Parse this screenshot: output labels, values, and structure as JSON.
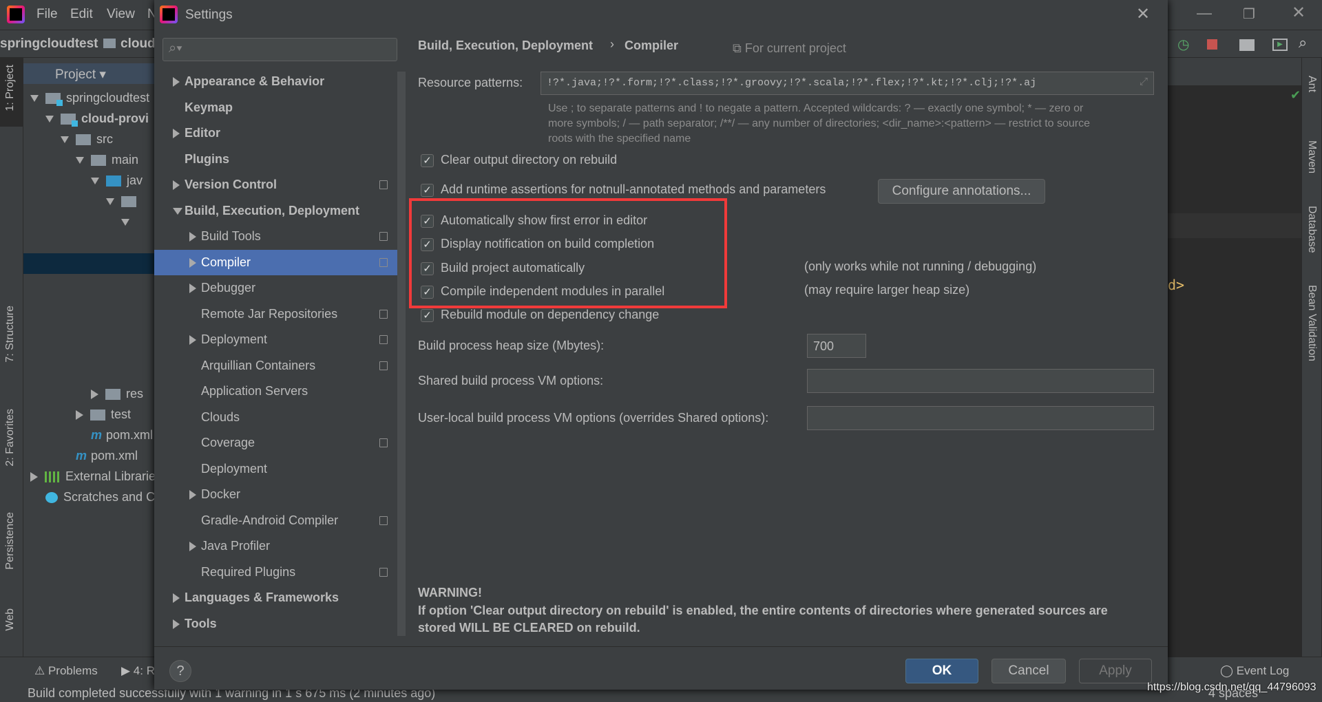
{
  "ide": {
    "menu": [
      "File",
      "Edit",
      "View",
      "N"
    ],
    "breadcrumb": [
      "springcloudtest",
      "cloud"
    ],
    "left_stripe": [
      "1: Project",
      "7: Structure",
      "2: Favorites",
      "Persistence",
      "Web"
    ],
    "right_stripe": [
      "Ant",
      "Maven",
      "Database",
      "Bean Validation"
    ],
    "project_header": "Project",
    "tree": [
      {
        "label": "springcloudtest",
        "icon": "module-folder-icon",
        "expanded": true
      },
      {
        "label": "cloud-provi",
        "icon": "module-folder-icon",
        "expanded": true
      },
      {
        "label": "src",
        "icon": "folder-icon",
        "expanded": true
      },
      {
        "label": "main",
        "icon": "folder-icon",
        "expanded": true
      },
      {
        "label": "jav",
        "icon": "source-folder-icon",
        "expanded": true
      },
      {
        "label": "",
        "icon": "package-icon",
        "expanded": true
      },
      {
        "label": "",
        "icon": "",
        "expanded": true
      },
      {
        "label": "res",
        "icon": "resources-folder-icon",
        "expanded": false
      },
      {
        "label": "test",
        "icon": "folder-icon",
        "expanded": false
      },
      {
        "label": "pom.xml",
        "icon": "maven-icon"
      },
      {
        "label": "pom.xml",
        "icon": "maven-icon"
      },
      {
        "label": "External Librarie",
        "icon": "library-icon",
        "expanded": false
      },
      {
        "label": "Scratches and C",
        "icon": "scratches-icon"
      }
    ],
    "bottom_tabs": [
      "Problems",
      "4: R"
    ],
    "event_log": "Event Log",
    "status_text": "Build completed successfully with 1 warning in 1 s 675 ms (2 minutes ago)",
    "status_right": "4 spaces",
    "editor_fragment": "d>",
    "watermark": "https://blog.csdn.net/qq_44796093"
  },
  "dialog": {
    "title": "Settings",
    "search_placeholder": "",
    "tree": [
      {
        "label": "Appearance & Behavior",
        "level": 0,
        "arrow": true,
        "bold": true
      },
      {
        "label": "Keymap",
        "level": 0,
        "bold": true
      },
      {
        "label": "Editor",
        "level": 0,
        "arrow": true,
        "bold": true
      },
      {
        "label": "Plugins",
        "level": 0,
        "bold": true
      },
      {
        "label": "Version Control",
        "level": 0,
        "arrow": true,
        "bold": true,
        "project": true
      },
      {
        "label": "Build, Execution, Deployment",
        "level": 0,
        "arrow": "down",
        "bold": true
      },
      {
        "label": "Build Tools",
        "level": 1,
        "arrow": true,
        "project": true
      },
      {
        "label": "Compiler",
        "level": 1,
        "arrow": true,
        "project": true,
        "selected": true
      },
      {
        "label": "Debugger",
        "level": 1,
        "arrow": true
      },
      {
        "label": "Remote Jar Repositories",
        "level": 1,
        "project": true
      },
      {
        "label": "Deployment",
        "level": 1,
        "arrow": true,
        "project": true
      },
      {
        "label": "Arquillian Containers",
        "level": 1,
        "project": true
      },
      {
        "label": "Application Servers",
        "level": 1
      },
      {
        "label": "Clouds",
        "level": 1
      },
      {
        "label": "Coverage",
        "level": 1,
        "project": true
      },
      {
        "label": "Deployment",
        "level": 1
      },
      {
        "label": "Docker",
        "level": 1,
        "arrow": true
      },
      {
        "label": "Gradle-Android Compiler",
        "level": 1,
        "project": true
      },
      {
        "label": "Java Profiler",
        "level": 1,
        "arrow": true
      },
      {
        "label": "Required Plugins",
        "level": 1,
        "project": true
      },
      {
        "label": "Languages & Frameworks",
        "level": 0,
        "arrow": true,
        "bold": true
      },
      {
        "label": "Tools",
        "level": 0,
        "arrow": true,
        "bold": true
      }
    ],
    "breadcrumb": {
      "parent": "Build, Execution, Deployment",
      "sep": "›",
      "current": "Compiler",
      "scope": "For current project"
    },
    "resource_label": "Resource patterns:",
    "resource_value": "!?*.java;!?*.form;!?*.class;!?*.groovy;!?*.scala;!?*.flex;!?*.kt;!?*.clj;!?*.aj",
    "help_lines": [
      "Use ; to separate patterns and ! to negate a pattern. Accepted wildcards: ? — exactly one symbol; * — zero or",
      "more symbols; / — path separator; /**/ — any number of directories; <dir_name>:<pattern> — restrict to source",
      "roots with the specified name"
    ],
    "checkboxes": [
      {
        "label": "Clear output directory on rebuild",
        "checked": true
      },
      {
        "label": "Add runtime assertions for notnull-annotated methods and parameters",
        "checked": true
      },
      {
        "label": "Automatically show first error in editor",
        "checked": true
      },
      {
        "label": "Display notification on build completion",
        "checked": true
      },
      {
        "label": "Build project automatically",
        "checked": true,
        "note": "(only works while not running / debugging)"
      },
      {
        "label": "Compile independent modules in parallel",
        "checked": true,
        "note": "(may require larger heap size)"
      },
      {
        "label": "Rebuild module on dependency change",
        "checked": true
      }
    ],
    "configure_button": "Configure annotations...",
    "heap_label": "Build process heap size (Mbytes):",
    "heap_value": "700",
    "shared_vm_label": "Shared build process VM options:",
    "shared_vm_value": "",
    "user_vm_label": "User-local build process VM options (overrides Shared options):",
    "user_vm_value": "",
    "warning_title": "WARNING!",
    "warning_line1": "If option 'Clear output directory on rebuild' is enabled, the entire contents of directories where generated sources are",
    "warning_line2": "stored WILL BE CLEARED on rebuild.",
    "help_button": "?",
    "ok": "OK",
    "cancel": "Cancel",
    "apply": "Apply",
    "highlight_color": "#f03a3a",
    "selection_color": "#4b6eaf"
  }
}
